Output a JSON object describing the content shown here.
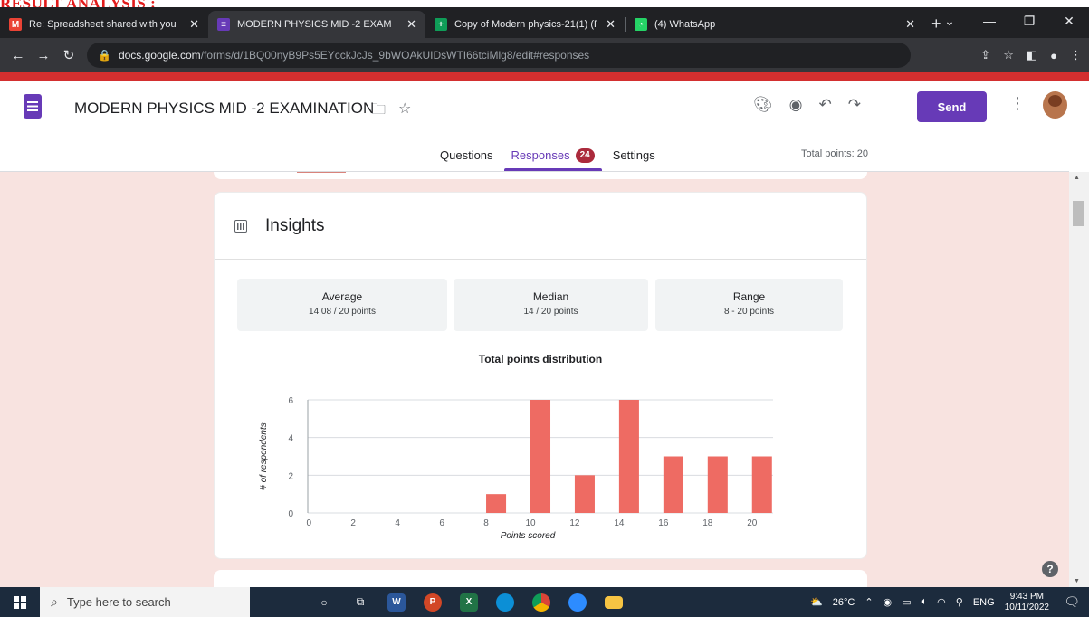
{
  "caption": "RESULT ANALYSIS :",
  "browser": {
    "tabs": [
      {
        "label": "Re: Spreadsheet shared with you",
        "icon": "gmail-icon",
        "color": "#ea4335",
        "active": false
      },
      {
        "label": "MODERN PHYSICS MID -2 EXAM",
        "icon": "forms-icon",
        "color": "#673ab7",
        "active": true
      },
      {
        "label": "Copy of Modern physics-21(1) (R",
        "icon": "sheets-icon",
        "color": "#0f9d58",
        "active": false
      },
      {
        "label": "(4) WhatsApp",
        "icon": "whatsapp-icon",
        "color": "#25d366",
        "active": false
      }
    ],
    "url_host": "docs.google.com",
    "url_path": "/forms/d/1BQ00nyB9Ps5EYcckJcJs_9bWOAkUIDsWTI66tciMlg8/edit#responses"
  },
  "form": {
    "title": "MODERN PHYSICS MID -2 EXAMINATION",
    "send_label": "Send",
    "tabs": {
      "questions": "Questions",
      "responses": "Responses",
      "responses_count": "24",
      "settings": "Settings"
    },
    "total_points": "Total points: 20"
  },
  "insights": {
    "title": "Insights",
    "stats": {
      "average": {
        "label": "Average",
        "value": "14.08 / 20 points"
      },
      "median": {
        "label": "Median",
        "value": "14 / 20 points"
      },
      "range": {
        "label": "Range",
        "value": "8 - 20 points"
      }
    }
  },
  "chart_data": {
    "type": "bar",
    "title": "Total points distribution",
    "xlabel": "Points scored",
    "ylabel": "# of respondents",
    "x": [
      0,
      1,
      2,
      3,
      4,
      5,
      6,
      7,
      8,
      9,
      10,
      11,
      12,
      13,
      14,
      15,
      16,
      17,
      18,
      19,
      20
    ],
    "values": [
      0,
      0,
      0,
      0,
      0,
      0,
      0,
      0,
      1,
      0,
      6,
      0,
      2,
      0,
      6,
      0,
      3,
      0,
      3,
      0,
      3
    ],
    "xticks": [
      0,
      2,
      4,
      6,
      8,
      10,
      12,
      14,
      16,
      18,
      20
    ],
    "yticks": [
      0,
      2,
      4,
      6
    ],
    "ylim": [
      0,
      6
    ],
    "bar_color": "#ee6b63",
    "grid": true
  },
  "taskbar": {
    "search_placeholder": "Type here to search",
    "weather": "26°C",
    "language": "ENG",
    "time": "9:43 PM",
    "date": "10/11/2022"
  }
}
